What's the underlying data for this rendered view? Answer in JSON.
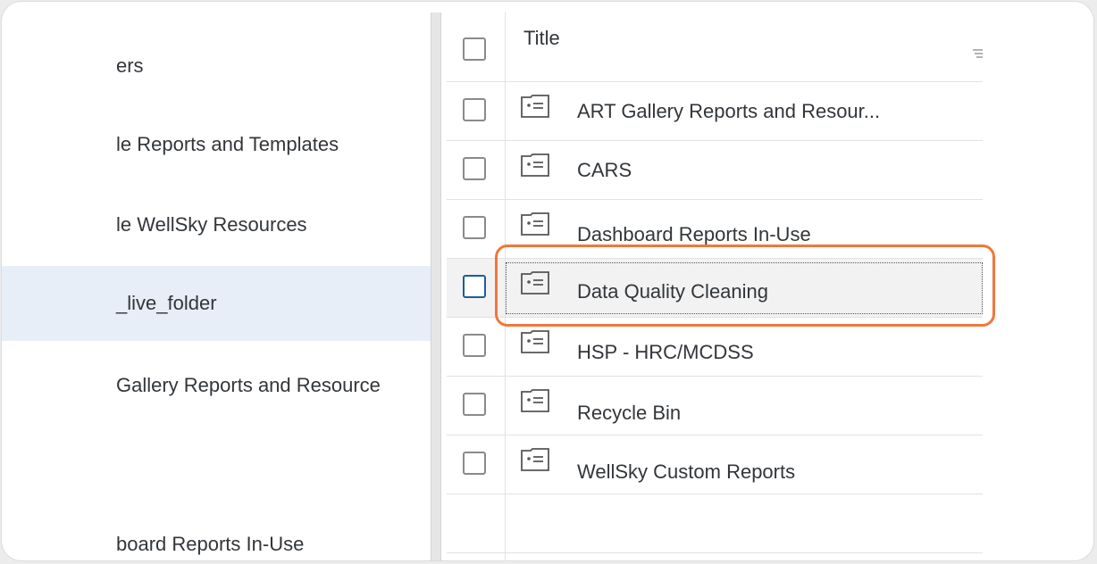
{
  "sidebar": {
    "items": [
      {
        "label": "ers"
      },
      {
        "label": "le Reports and Templates"
      },
      {
        "label": "le WellSky Resources"
      },
      {
        "label": "_live_folder",
        "selected": true
      },
      {
        "label": "Gallery Reports and Resource"
      },
      {
        "label": ""
      },
      {
        "label": "board Reports In-Use"
      }
    ]
  },
  "table": {
    "header": {
      "title": "Title"
    },
    "rows": [
      {
        "title": "ART Gallery Reports and Resour..."
      },
      {
        "title": "CARS"
      },
      {
        "title": "Dashboard Reports In-Use"
      },
      {
        "title": "Data Quality Cleaning",
        "focused": true
      },
      {
        "title": "HSP - HRC/MCDSS"
      },
      {
        "title": "Recycle Bin"
      },
      {
        "title": "WellSky Custom Reports"
      }
    ]
  },
  "colors": {
    "accent": "#f0773a",
    "selected_bg": "#e8eef7",
    "focus_checkbox": "#1a5e9e"
  },
  "icons": {
    "folder": "folder-list-icon",
    "sort": "sort-icon"
  }
}
